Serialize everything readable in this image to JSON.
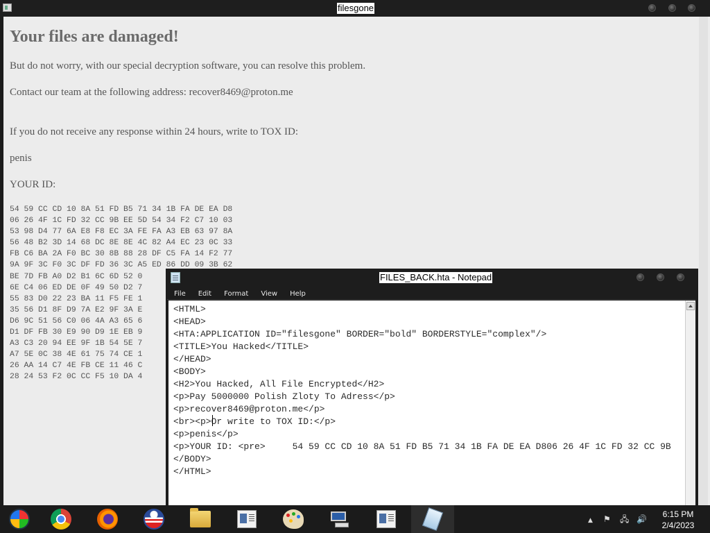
{
  "hta_window": {
    "title": "filesgone",
    "heading": "Your files are damaged!",
    "p1": "But do not worry, with our special decryption software, you can resolve this problem.",
    "p2": "Contact our team at the following address: recover8469@proton.me",
    "p3": "If you do not receive any response within 24 hours, write to TOX ID:",
    "p4": "penis",
    "p5": "YOUR ID:",
    "id_block": "54 59 CC CD 10 8A 51 FD B5 71 34 1B FA DE EA D8\n06 26 4F 1C FD 32 CC 9B EE 5D 54 34 F2 C7 10 03\n53 98 D4 77 6A E8 F8 EC 3A FE FA A3 EB 63 97 8A\n56 48 B2 3D 14 68 DC 8E 8E 4C 82 A4 EC 23 0C 33\nFB C6 BA 2A F0 BC 30 8B 88 28 DF C5 FA 14 F2 77\n9A 9F 3C F0 3C DF FD 36 3C A5 ED 86 DD 09 3B 62\nBE 7D FB A0 D2 B1 6C 6D 52 0\n6E C4 06 ED DE 0F 49 50 D2 7\n55 83 D0 22 23 BA 11 F5 FE 1\n35 56 D1 8F D9 7A E2 9F 3A E\nD6 9C 51 56 C0 06 4A A3 65 6\nD1 DF FB 30 E9 90 D9 1E EB 9\nA3 C3 20 94 EE 9F 1B 54 5E 7\nA7 5E 0C 38 4E 61 75 74 CE 1\n26 AA 14 C7 4E FB CE 11 46 C\n28 24 53 F2 0C CC F5 10 DA 4"
  },
  "notepad": {
    "title": "FILES_BACK.hta - Notepad",
    "menu": [
      "File",
      "Edit",
      "Format",
      "View",
      "Help"
    ],
    "content": "<HTML>\n<HEAD>\n<HTA:APPLICATION ID=\"filesgone\" BORDER=\"bold\" BORDERSTYLE=\"complex\"/>\n<TITLE>You Hacked</TITLE>\n</HEAD>\n<BODY>\n<H2>You Hacked, All File Encrypted</H2>\n<p>Pay 5000000 Polish Zloty To Adress</p>\n<p>recover8469@proton.me</p>\n<br><p>Or write to TOX ID:</p>\n<p>penis</p>\n<p>YOUR ID: <pre>     54 59 CC CD 10 8A 51 FD B5 71 34 1B FA DE EA D806 26 4F 1C FD 32 CC 9B\n</BODY>\n</HTML>"
  },
  "taskbar": {
    "apps": [
      "start-orb",
      "chrome",
      "firefox",
      "obama-campaign",
      "file-explorer",
      "document",
      "paint",
      "network",
      "document",
      "notepad"
    ],
    "clock_time": "6:15 PM",
    "clock_date": "2/4/2023"
  }
}
